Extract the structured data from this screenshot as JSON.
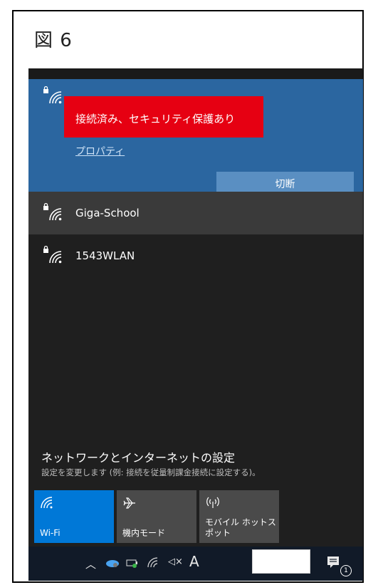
{
  "figure": {
    "label": "図 6"
  },
  "wifi": {
    "connected": {
      "status": "接続済み、セキュリティ保護あり",
      "properties_label": "プロパティ",
      "disconnect_label": "切断"
    },
    "networks": [
      {
        "name": "Giga-School",
        "secured": true
      },
      {
        "name": "1543WLAN",
        "secured": true
      }
    ]
  },
  "settings": {
    "title": "ネットワークとインターネットの設定",
    "subtitle": "設定を変更します (例: 接続を従量制課金接続に設定する)。"
  },
  "quick_actions": [
    {
      "label": "Wi-Fi",
      "active": true,
      "icon": "wifi-icon"
    },
    {
      "label": "機内モード",
      "active": false,
      "icon": "airplane-icon"
    },
    {
      "label": "モバイル ホットス\nポット",
      "active": false,
      "icon": "hotspot-icon"
    }
  ],
  "taskbar": {
    "ime_label": "A",
    "notification_count": "1"
  },
  "colors": {
    "accent": "#0078d7",
    "connected_bg": "#2b66a0",
    "highlight": "#e60012"
  }
}
